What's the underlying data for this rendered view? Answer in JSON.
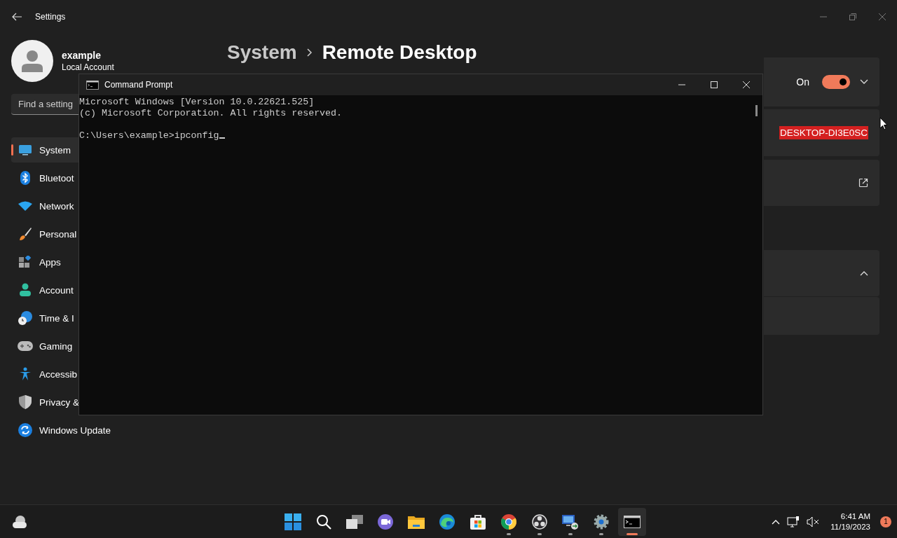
{
  "settings_window": {
    "title": "Settings",
    "user": {
      "name": "example",
      "account_type": "Local Account"
    },
    "search": {
      "placeholder": "Find a setting"
    },
    "nav_items": [
      {
        "kind": "system",
        "label": "System",
        "selected": true
      },
      {
        "kind": "bluetooth",
        "label": "Bluetoot",
        "selected": false
      },
      {
        "kind": "network",
        "label": "Network",
        "selected": false
      },
      {
        "kind": "brush",
        "label": "Personal",
        "selected": false
      },
      {
        "kind": "apps",
        "label": "Apps",
        "selected": false
      },
      {
        "kind": "person",
        "label": "Account",
        "selected": false
      },
      {
        "kind": "clock",
        "label": "Time & I",
        "selected": false
      },
      {
        "kind": "gamepad",
        "label": "Gaming",
        "selected": false
      },
      {
        "kind": "accessibility",
        "label": "Accessib",
        "selected": false
      },
      {
        "kind": "shield",
        "label": "Privacy &",
        "selected": false
      },
      {
        "kind": "update",
        "label": "Windows Update",
        "selected": false
      }
    ],
    "breadcrumb": {
      "parent": "System",
      "current": "Remote Desktop"
    },
    "cards": [
      {
        "kind": "toggle",
        "state_label": "On",
        "on": true,
        "expanded": false
      },
      {
        "kind": "value",
        "value": "DESKTOP-DI3E0SC"
      },
      {
        "kind": "link"
      },
      {
        "kind": "expander",
        "expanded": true
      },
      {
        "kind": "blank"
      }
    ]
  },
  "cmd_window": {
    "title": "Command Prompt",
    "lines": [
      {
        "kind": "output",
        "text": "Microsoft Windows [Version 10.0.22621.525]"
      },
      {
        "kind": "output",
        "text": "(c) Microsoft Corporation. All rights reserved."
      },
      {
        "kind": "prompt",
        "text": "C:\\Users\\example>ipconfig"
      }
    ]
  },
  "taskbar": {
    "apps": [
      {
        "kind": "start",
        "running": false,
        "active": false
      },
      {
        "kind": "search",
        "running": false,
        "active": false
      },
      {
        "kind": "taskview",
        "running": false,
        "active": false
      },
      {
        "kind": "chat",
        "running": false,
        "active": false
      },
      {
        "kind": "folder",
        "running": false,
        "active": false
      },
      {
        "kind": "browser-wave",
        "running": false,
        "active": false
      },
      {
        "kind": "store",
        "running": false,
        "active": false
      },
      {
        "kind": "browser-ring",
        "running": true,
        "active": false
      },
      {
        "kind": "aperture",
        "running": true,
        "active": false
      },
      {
        "kind": "remote",
        "running": true,
        "active": false
      },
      {
        "kind": "gear",
        "running": true,
        "active": false
      },
      {
        "kind": "terminal",
        "running": true,
        "active": true
      }
    ],
    "time": "6:41 AM",
    "date": "11/19/2023",
    "notification_count": "1"
  }
}
